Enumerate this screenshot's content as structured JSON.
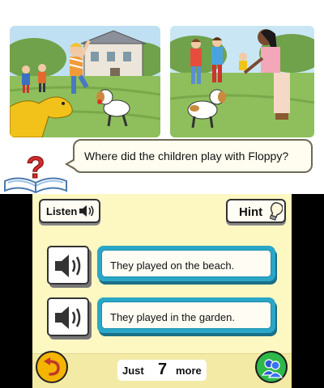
{
  "question": {
    "text": "Where did the children play with Floppy?"
  },
  "toolbar": {
    "listen_label": "Listen",
    "hint_label": "Hint"
  },
  "answers": [
    {
      "text": "They played on the beach."
    },
    {
      "text": "They played in the garden."
    }
  ],
  "counter": {
    "prefix": "Just",
    "number": "7",
    "suffix": "more"
  },
  "icons": [
    "question-book-icon",
    "speaker-icon",
    "light-bulb-icon",
    "back-arrow-icon",
    "friends-icon"
  ],
  "colors": {
    "answer_border": "#2aa7c7",
    "bottom_background": "#fdf7c2",
    "back_button": "#f4b400",
    "friends_button": "#2fb84a"
  }
}
